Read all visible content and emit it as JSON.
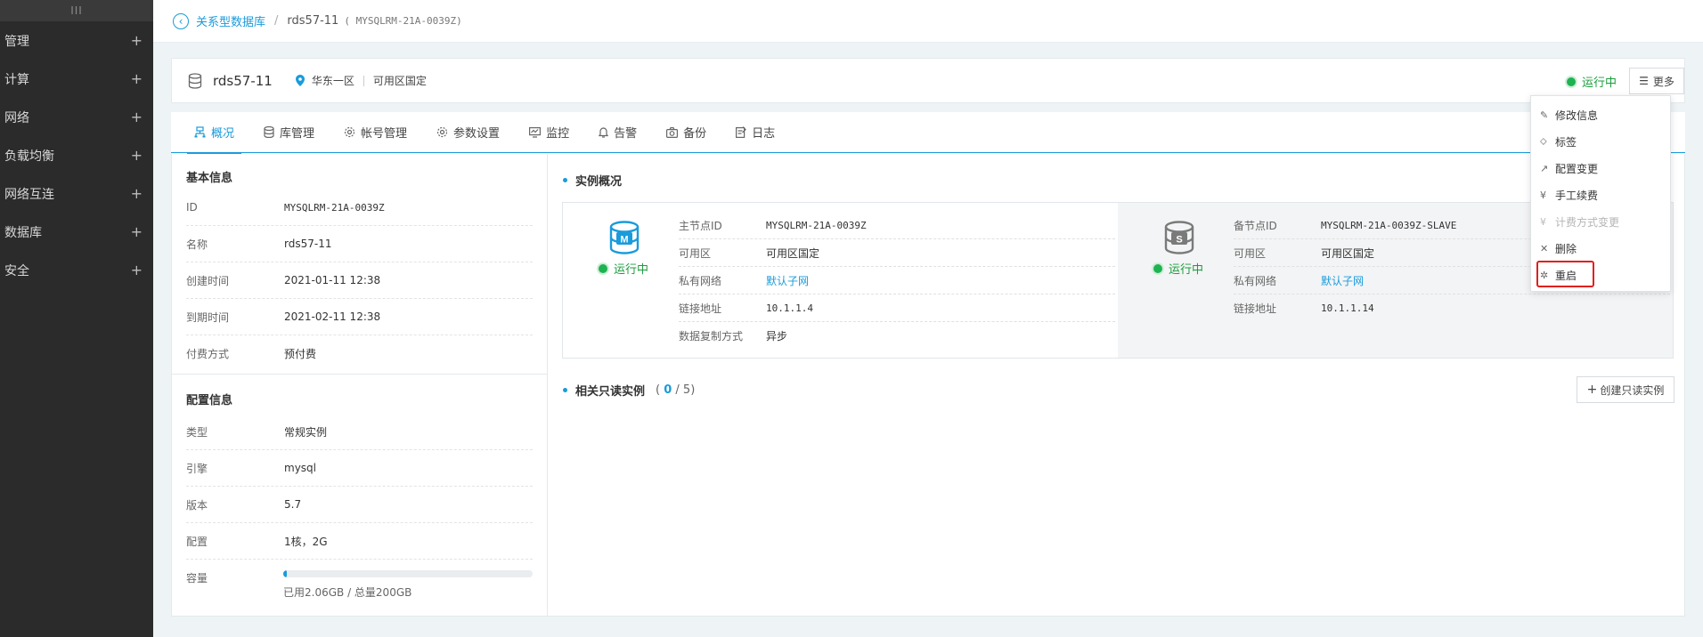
{
  "sidebar": {
    "top_glyph": "III",
    "items": [
      {
        "label": "管理"
      },
      {
        "label": "计算"
      },
      {
        "label": "网络"
      },
      {
        "label": "负载均衡"
      },
      {
        "label": "网络互连"
      },
      {
        "label": "数据库"
      },
      {
        "label": "安全"
      }
    ],
    "plus": "+"
  },
  "breadcrumb": {
    "parent": "关系型数据库",
    "separator": "/",
    "current": "rds57-11",
    "instance_id": "( MYSQLRM-21A-0039Z)"
  },
  "header": {
    "name": "rds57-11",
    "region": "华东一区",
    "zone": "可用区国定",
    "status": "运行中",
    "more": "更多"
  },
  "tabs": [
    {
      "label": "概况",
      "icon": "overview-icon"
    },
    {
      "label": "库管理",
      "icon": "database-icon"
    },
    {
      "label": "帐号管理",
      "icon": "account-gear-icon"
    },
    {
      "label": "参数设置",
      "icon": "params-gear-icon"
    },
    {
      "label": "监控",
      "icon": "monitor-icon"
    },
    {
      "label": "告警",
      "icon": "bell-icon"
    },
    {
      "label": "备份",
      "icon": "camera-icon"
    },
    {
      "label": "日志",
      "icon": "log-icon"
    }
  ],
  "basic": {
    "title": "基本信息",
    "rows": [
      {
        "k": "ID",
        "v": "MYSQLRM-21A-0039Z"
      },
      {
        "k": "名称",
        "v": "rds57-11"
      },
      {
        "k": "创建时间",
        "v": "2021-01-11 12:38"
      },
      {
        "k": "到期时间",
        "v": "2021-02-11 12:38"
      },
      {
        "k": "付费方式",
        "v": "预付费"
      }
    ]
  },
  "config": {
    "title": "配置信息",
    "rows": [
      {
        "k": "类型",
        "v": "常规实例"
      },
      {
        "k": "引擎",
        "v": "mysql"
      },
      {
        "k": "版本",
        "v": "5.7"
      },
      {
        "k": "配置",
        "v": "1核，2G"
      }
    ],
    "capacity_label": "容量",
    "capacity_text": "已用2.06GB / 总量200GB",
    "capacity_fraction": 0.0103
  },
  "overview": {
    "title": "实例概况",
    "master": {
      "status": "运行中",
      "icon_letter": "M",
      "rows": [
        {
          "k": "主节点ID",
          "v": "MYSQLRM-21A-0039Z"
        },
        {
          "k": "可用区",
          "v": "可用区国定"
        },
        {
          "k": "私有网络",
          "v": "默认子网"
        },
        {
          "k": "链接地址",
          "v": "10.1.1.4"
        },
        {
          "k": "数据复制方式",
          "v": "异步"
        }
      ]
    },
    "slave": {
      "status": "运行中",
      "icon_letter": "S",
      "rows": [
        {
          "k": "备节点ID",
          "v": "MYSQLRM-21A-0039Z-SLAVE"
        },
        {
          "k": "可用区",
          "v": "可用区国定"
        },
        {
          "k": "私有网络",
          "v": "默认子网"
        },
        {
          "k": "链接地址",
          "v": "10.1.1.14"
        }
      ]
    }
  },
  "readonly": {
    "title": "相关只读实例",
    "count_open": "(",
    "count": "0",
    "count_total": "/ 5)",
    "create_label": "创建只读实例"
  },
  "menu": {
    "items": [
      {
        "label": "修改信息",
        "icon": "edit-icon",
        "glyph": "✎",
        "disabled": false
      },
      {
        "label": "标签",
        "icon": "tag-icon",
        "glyph": "⬦",
        "disabled": false
      },
      {
        "label": "配置变更",
        "icon": "trend-icon",
        "glyph": "↗",
        "disabled": false
      },
      {
        "label": "手工续费",
        "icon": "yen-icon",
        "glyph": "¥",
        "disabled": false
      },
      {
        "label": "计费方式变更",
        "icon": "yen-icon",
        "glyph": "¥",
        "disabled": true
      },
      {
        "label": "删除",
        "icon": "close-icon",
        "glyph": "✕",
        "disabled": false
      },
      {
        "label": "重启",
        "icon": "restart-icon",
        "glyph": "✲",
        "disabled": false
      }
    ]
  },
  "colors": {
    "accent": "#1a9bdb",
    "running": "#1b9c3c",
    "highlight": "#e0201c"
  }
}
